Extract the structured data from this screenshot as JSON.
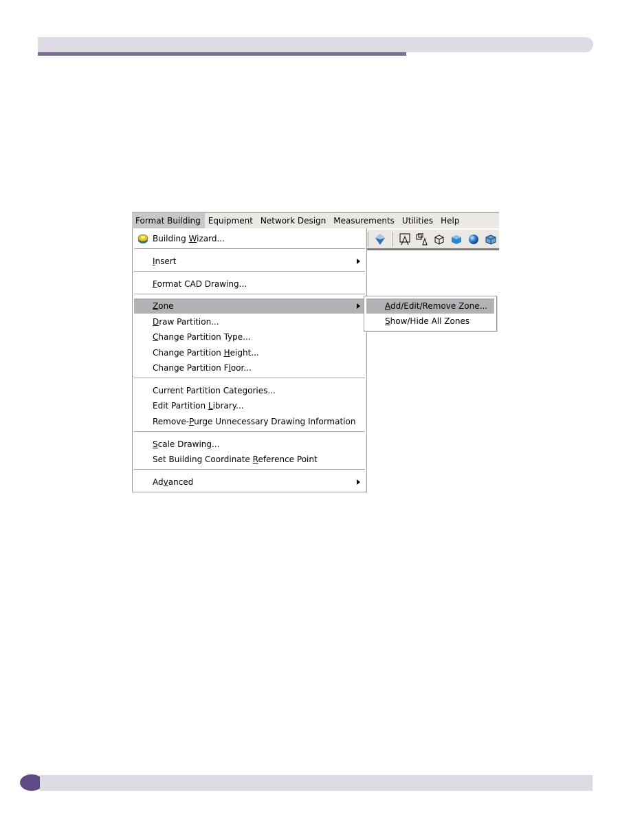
{
  "page": {
    "header_band": "",
    "footer_band": ""
  },
  "menubar": {
    "items": [
      {
        "label": "Format Building",
        "active": true
      },
      {
        "label": "Equipment"
      },
      {
        "label": "Network Design"
      },
      {
        "label": "Measurements"
      },
      {
        "label": "Utilities"
      },
      {
        "label": "Help"
      }
    ]
  },
  "toolbar": {
    "icons": [
      "view-3d-shaded-icon",
      "partition-a-icon",
      "objects-icon",
      "wireframe-cube-icon",
      "solid-cube-icon",
      "sphere-icon",
      "shaded-cube-icon"
    ]
  },
  "menu": {
    "items": [
      {
        "pre": "Building ",
        "ul": "W",
        "post": "izard...",
        "icon": "building-wizard-icon"
      },
      {
        "pre": "",
        "ul": "I",
        "post": "nsert",
        "submenu": true
      },
      {
        "pre": "",
        "ul": "F",
        "post": "ormat CAD Drawing..."
      },
      {
        "pre": "",
        "ul": "Z",
        "post": "one",
        "submenu": true,
        "highlighted": true
      },
      {
        "pre": "",
        "ul": "D",
        "post": "raw Partition..."
      },
      {
        "pre": "",
        "ul": "C",
        "post": "hange Partition Type..."
      },
      {
        "pre": "Change Partition ",
        "ul": "H",
        "post": "eight..."
      },
      {
        "pre": "Change Partition F",
        "ul": "l",
        "post": "oor..."
      },
      {
        "pre": "Current Partition Categories...",
        "ul": "",
        "post": ""
      },
      {
        "pre": "Edit Partition ",
        "ul": "L",
        "post": "ibrary..."
      },
      {
        "pre": "Remove-",
        "ul": "P",
        "post": "urge Unnecessary Drawing Information"
      },
      {
        "pre": "",
        "ul": "S",
        "post": "cale Drawing..."
      },
      {
        "pre": "Set Building Coordinate ",
        "ul": "R",
        "post": "eference Point"
      },
      {
        "pre": "Ad",
        "ul": "v",
        "post": "anced",
        "submenu": true
      }
    ]
  },
  "submenu": {
    "items": [
      {
        "pre": "",
        "ul": "A",
        "post": "dd/Edit/Remove Zone...",
        "highlighted": true
      },
      {
        "pre": "",
        "ul": "S",
        "post": "how/Hide All Zones"
      }
    ]
  },
  "colors": {
    "accent_purple": "#7a6a92",
    "band_gray": "#dcdbe3",
    "footer_dot": "#5f4a86",
    "menu_highlight": "#b2b1b6"
  }
}
